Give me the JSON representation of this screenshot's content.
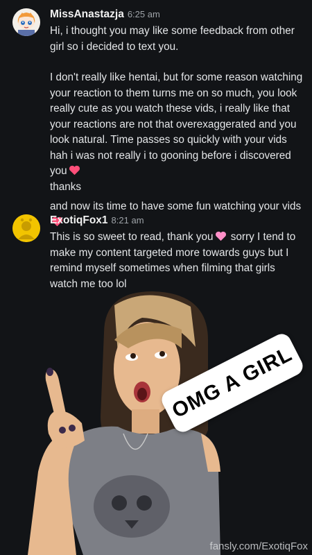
{
  "messages": [
    {
      "username": "MissAnastazja",
      "time": "6:25 am",
      "avatar_icon": "anime-girl-avatar-icon",
      "lines": [
        "Hi, i thought you may like some feedback from other girl so i decided to text you.",
        "I don't really like hentai, but for some reason watching your reaction to them turns me on so much, you look really cute as you watch these vids, i really like that your reactions are not that overexaggerated and you look natural. Time passes so quickly with your vids hah i was not really i to gooning before i discovered you",
        "thanks",
        "and now its time to have some fun watching your vids"
      ]
    },
    {
      "username": "ExotiqFox1",
      "time": "8:21 am",
      "avatar_icon": "default-user-avatar-icon",
      "lines": [
        "This is so sweet to read, thank you",
        "sorry I tend to make my content targeted more towards guys but I remind myself sometimes when filming that girls watch me too lol"
      ]
    }
  ],
  "sticker": {
    "caption": "OMG A GIRL"
  },
  "watermark": "fansly.com/ExotiqFox",
  "colors": {
    "background": "#121417",
    "heart_red": "#ff4f7a",
    "heart_pink": "#ff8fc8",
    "avatar_yellow": "#f2c400"
  }
}
